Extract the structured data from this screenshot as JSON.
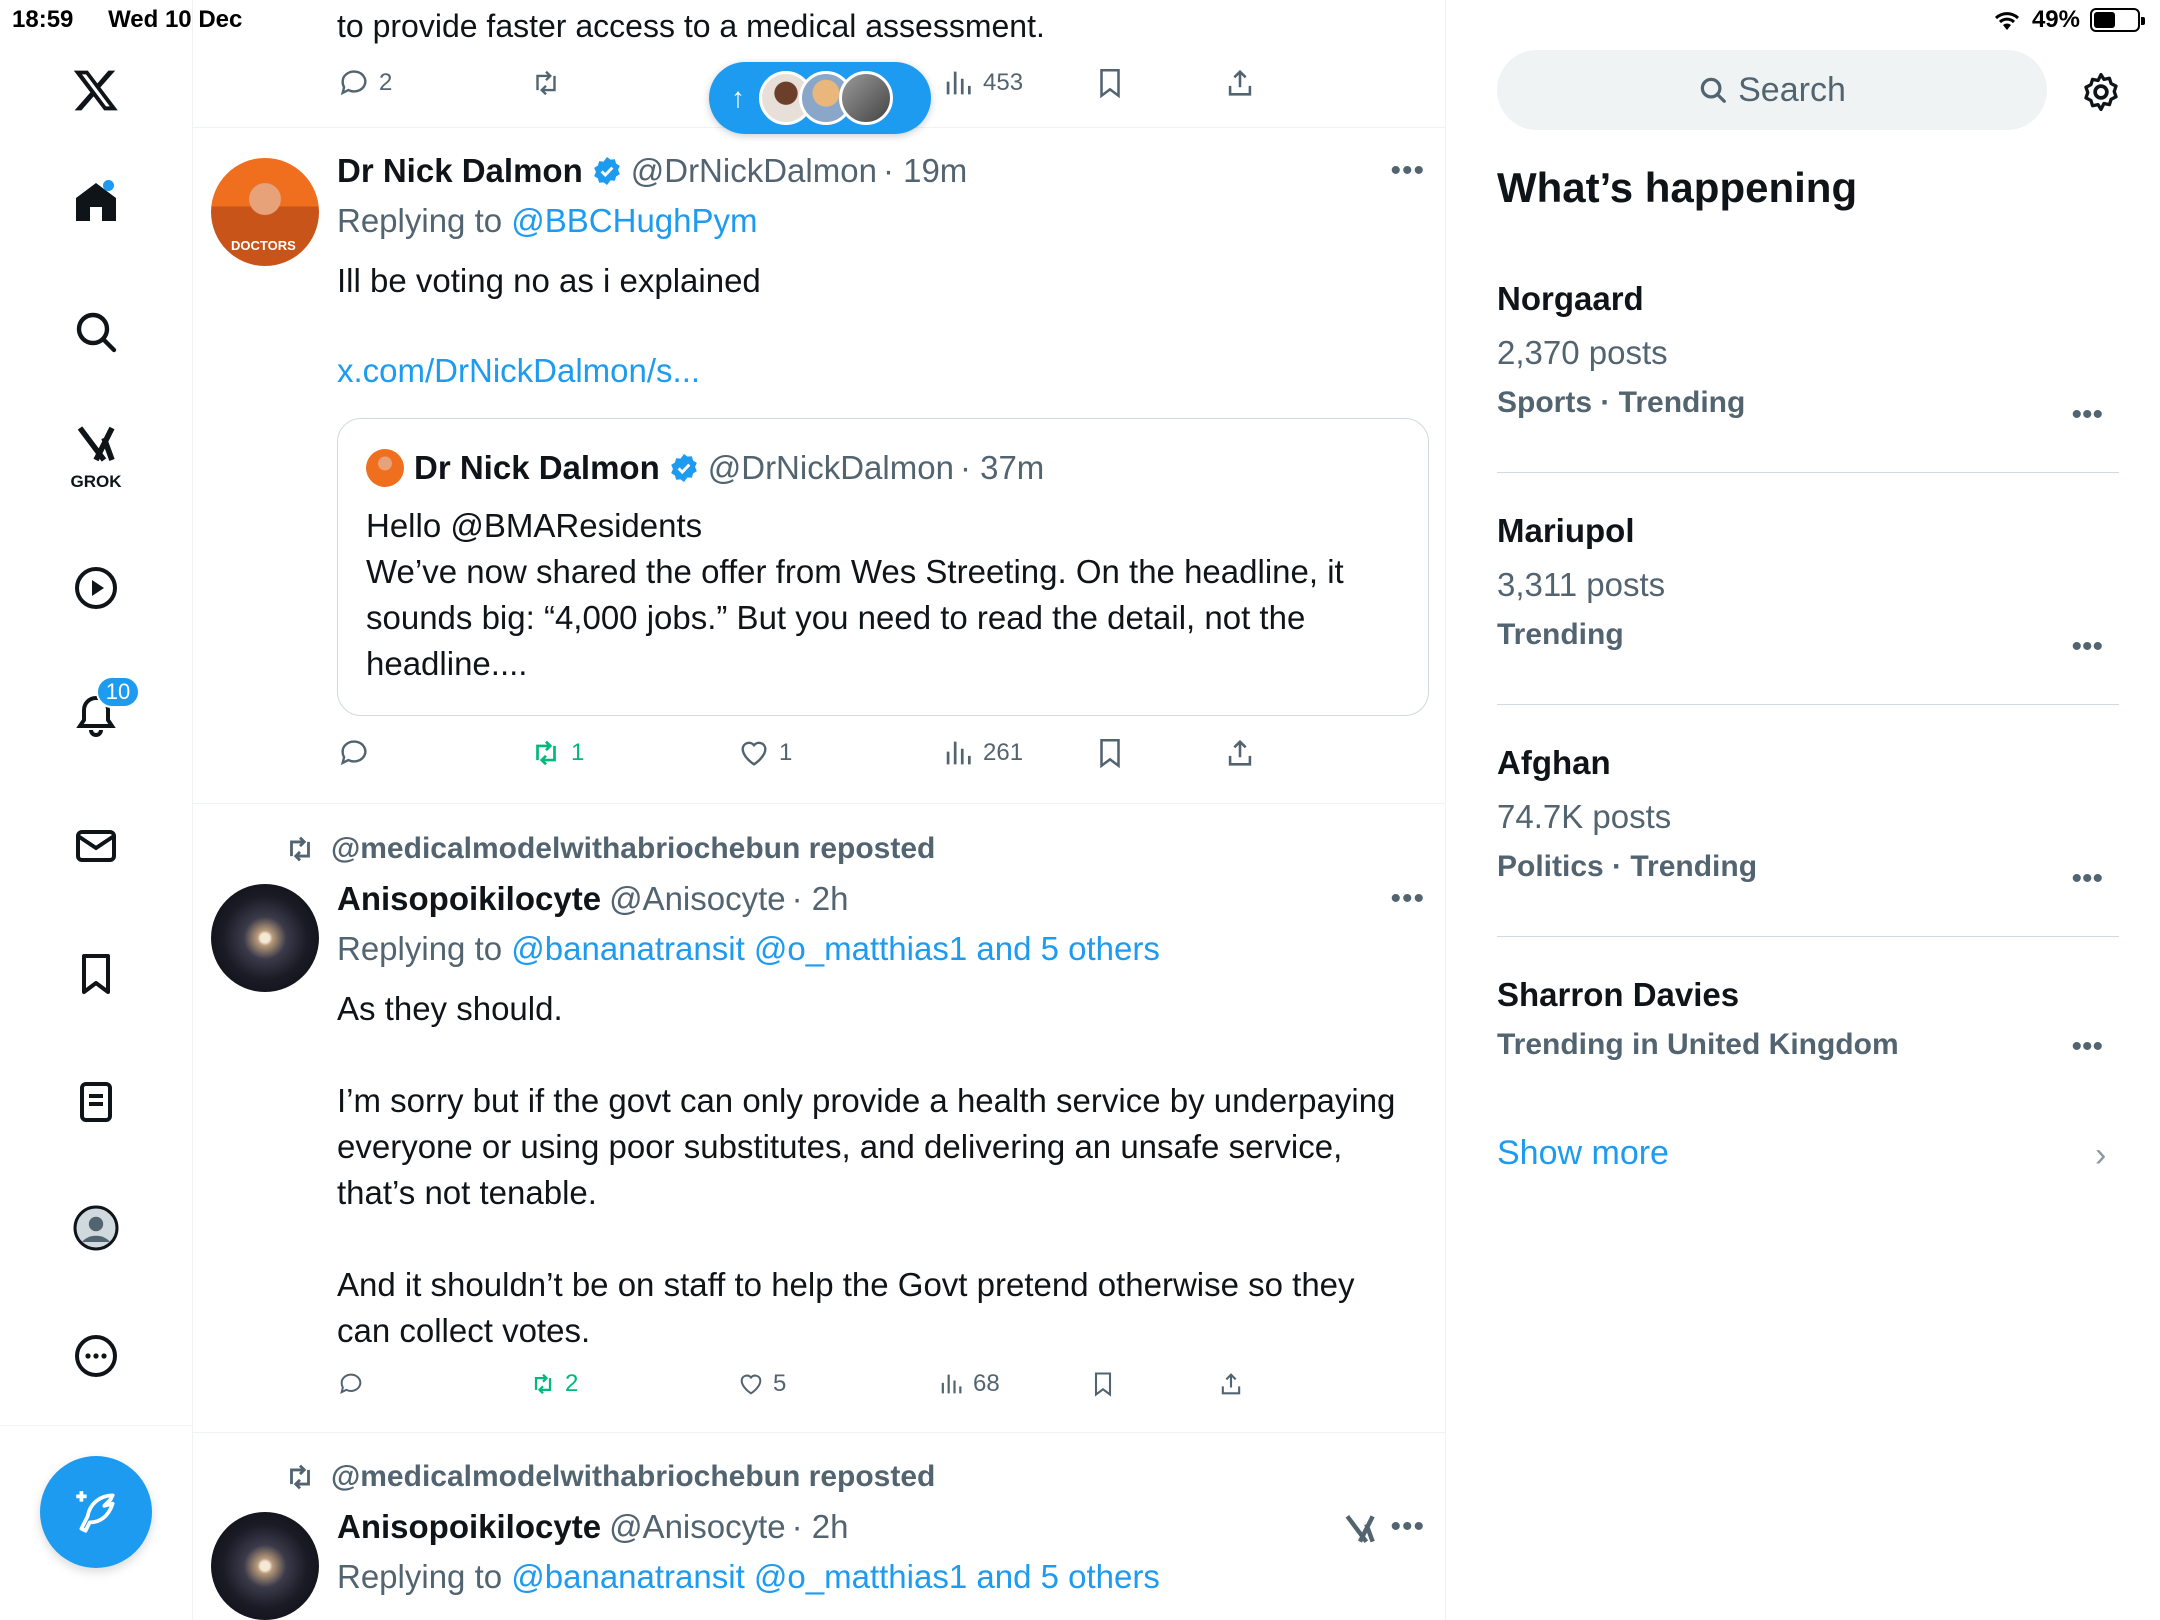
{
  "status_bar": {
    "time": "18:59",
    "date": "Wed 10 Dec",
    "battery": "49%",
    "battery_level": 0.49
  },
  "nav": {
    "grok_label": "GROK",
    "notifications_count": "10"
  },
  "new_posts_pill": {
    "arrow": "↑"
  },
  "top_fragment": {
    "text": "to provide faster access to a medical assessment.",
    "replies": "2",
    "views": "453"
  },
  "posts": [
    {
      "name": "Dr Nick Dalmon",
      "handle": "@DrNickDalmon",
      "time": "· 19m",
      "replying_prefix": "Replying to ",
      "replying_to": "@BBCHughPym",
      "text": "Ill be voting no as i explained",
      "link": "x.com/DrNickDalmon/s...",
      "avatar_text": "DOCTORS",
      "quote": {
        "name": "Dr Nick Dalmon",
        "handle": "@DrNickDalmon",
        "time": "· 37m",
        "text": "Hello @BMAResidents\nWe’ve now shared the offer from Wes Streeting. On the headline, it sounds big: “4,000 jobs.” But you need to read the detail, not the headline...."
      },
      "reposts": "1",
      "likes": "1",
      "views": "261"
    },
    {
      "repost_by": "@medicalmodelwithabriochebun reposted",
      "name": "Anisopoikilocyte",
      "handle": "@Anisocyte",
      "time": "· 2h",
      "replying_prefix": "Replying to ",
      "replying_to": "@bananatransit @o_matthias1 and 5 others",
      "text": "As they should.\n\nI’m sorry but if the govt can only provide a health service by underpaying everyone or using poor substitutes, and delivering an unsafe service, that’s not tenable.\n\nAnd it shouldn’t be on staff to help the Govt pretend otherwise so they can collect votes.",
      "reposts": "2",
      "likes": "5",
      "views": "68"
    },
    {
      "repost_by": "@medicalmodelwithabriochebun reposted",
      "name": "Anisopoikilocyte",
      "handle": "@Anisocyte",
      "time": "· 2h",
      "replying_prefix": "Replying to ",
      "replying_to": "@bananatransit @o_matthias1 and 5 others"
    }
  ],
  "sidebar": {
    "search_placeholder": "Search",
    "title": "What’s happening",
    "trends": [
      {
        "name": "Norgaard",
        "count": "2,370 posts",
        "meta": "Sports · Trending"
      },
      {
        "name": "Mariupol",
        "count": "3,311 posts",
        "meta": "Trending"
      },
      {
        "name": "Afghan",
        "count": "74.7K posts",
        "meta": "Politics · Trending"
      },
      {
        "name": "Sharron Davies",
        "count": "",
        "meta": "Trending in United Kingdom"
      }
    ],
    "show_more": "Show more"
  },
  "colors": {
    "accent": "#1d9bf0",
    "repost_green": "#00ba7c",
    "secondary_text": "#536471"
  }
}
